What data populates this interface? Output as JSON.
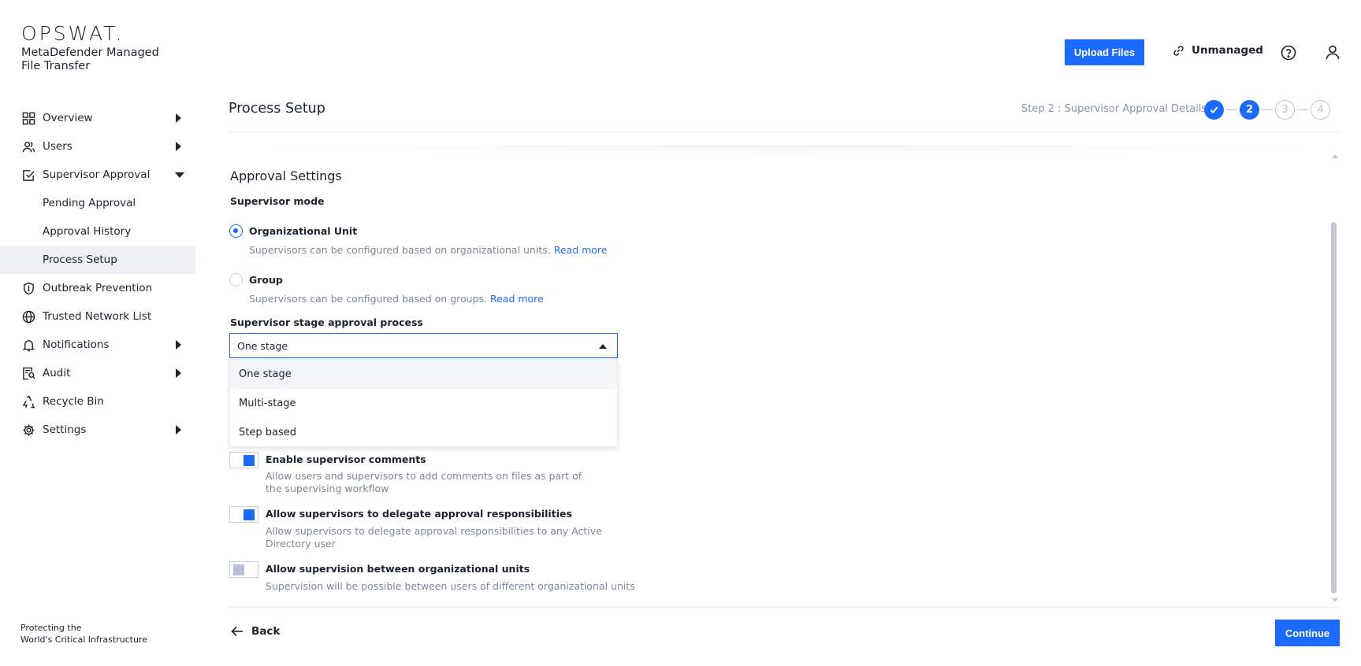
{
  "brand": {
    "logo": "OPSWAT.",
    "product_name": "MetaDefender Managed File Transfer",
    "tagline_line1": "Protecting the",
    "tagline_line2": "World's Critical Infrastructure"
  },
  "sidebar": {
    "items": [
      {
        "label": "Overview",
        "icon": "grid-icon",
        "expandable": true
      },
      {
        "label": "Users",
        "icon": "users-icon",
        "expandable": true
      },
      {
        "label": "Supervisor Approval",
        "icon": "checkbox-icon",
        "expanded": true
      },
      {
        "label": "Pending Approval",
        "sub": true
      },
      {
        "label": "Approval History",
        "sub": true
      },
      {
        "label": "Process Setup",
        "sub": true,
        "active": true
      },
      {
        "label": "Outbreak Prevention",
        "icon": "shield-icon"
      },
      {
        "label": "Trusted Network List",
        "icon": "globe-icon"
      },
      {
        "label": "Notifications",
        "icon": "bell-icon",
        "expandable": true
      },
      {
        "label": "Audit",
        "icon": "audit-icon",
        "expandable": true
      },
      {
        "label": "Recycle Bin",
        "icon": "recycle-icon"
      },
      {
        "label": "Settings",
        "icon": "gear-icon",
        "expandable": true
      }
    ]
  },
  "header": {
    "upload_label": "Upload Files",
    "unmanaged_label": "Unmanaged"
  },
  "page": {
    "title": "Process Setup",
    "step_text": "Step 2 : Supervisor Approval Details",
    "steps": [
      "✓",
      "2",
      "3",
      "4"
    ]
  },
  "settings": {
    "section_title": "Approval Settings",
    "supervisor_mode_label": "Supervisor mode",
    "mode_options": [
      {
        "label": "Organizational Unit",
        "desc": "Supervisors can be configured based on organizational units.",
        "link": "Read more",
        "checked": true
      },
      {
        "label": "Group",
        "desc": "Supervisors can be configured based on groups.",
        "link": "Read more",
        "checked": false
      }
    ],
    "stage_label": "Supervisor stage approval process",
    "stage_selected": "One stage",
    "stage_options": [
      "One stage",
      "Multi-stage",
      "Step based"
    ],
    "toggles": [
      {
        "label": "Enable supervisor comments",
        "desc": "Allow users and supervisors to add comments on files as part of the supervising workflow",
        "on": true
      },
      {
        "label": "Allow supervisors to delegate approval responsibilities",
        "desc": "Allow supervisors to delegate approval responsibilities to any Active Directory user",
        "on": true
      },
      {
        "label": "Allow supervision between organizational units",
        "desc": "Supervision will be possible between users of different organizational units",
        "on": false
      }
    ]
  },
  "footer": {
    "back_label": "Back",
    "continue_label": "Continue"
  },
  "colors": {
    "accent": "#1d6bfc",
    "text": "#1d2330",
    "muted": "#7e8798"
  }
}
